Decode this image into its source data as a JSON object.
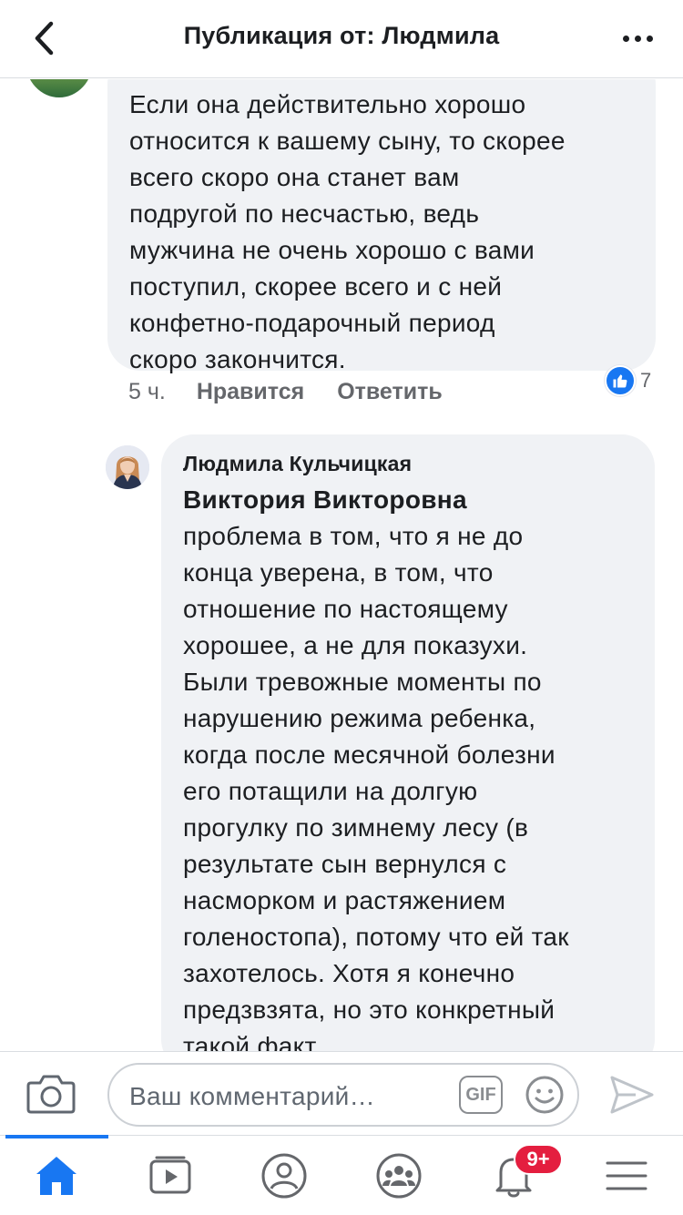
{
  "header": {
    "title": "Публикация от: Людмила"
  },
  "comment1": {
    "text": "Если она действительно хорошо\nотносится к вашему сыну, то скорее\nвсего скоро она станет вам\nподругой по несчастью, ведь\nмужчина не очень хорошо с вами\nпоступил, скорее всего и с ней\nконфетно-подарочный период\nскоро закончится.",
    "time": "5 ч.",
    "like_label": "Нравится",
    "reply_label": "Ответить",
    "reaction_count": "7"
  },
  "comment2": {
    "author": "Людмила Кульчицкая",
    "mention": "Виктория Викторовна",
    "text": "проблема в том, что я не до\nконца уверена, в том, что\nотношение по настоящему\nхорошее, а не для показухи.\nБыли тревожные моменты по\nнарушению режима ребенка,\nкогда после месячной болезни\nего потащили на долгую\nпрогулку по зимнему лесу (в\nрезультате сын вернулся с\nнасморком и растяжением\nголеностопа), потому что ей так\nзахотелось.  Хотя я конечно\nпредзвзята, но это конкретный\nтакой факт"
  },
  "input": {
    "placeholder": "Ваш комментарий…",
    "gif_label": "GIF"
  },
  "tabbar": {
    "notifications_badge": "9+",
    "active_tab": "home",
    "tabs": [
      "home",
      "watch",
      "profile",
      "groups",
      "notifications",
      "menu"
    ]
  },
  "colors": {
    "accent": "#1877f2",
    "bubble": "#f0f2f5",
    "secondary_text": "#65676b",
    "badge": "#e41e3f"
  }
}
